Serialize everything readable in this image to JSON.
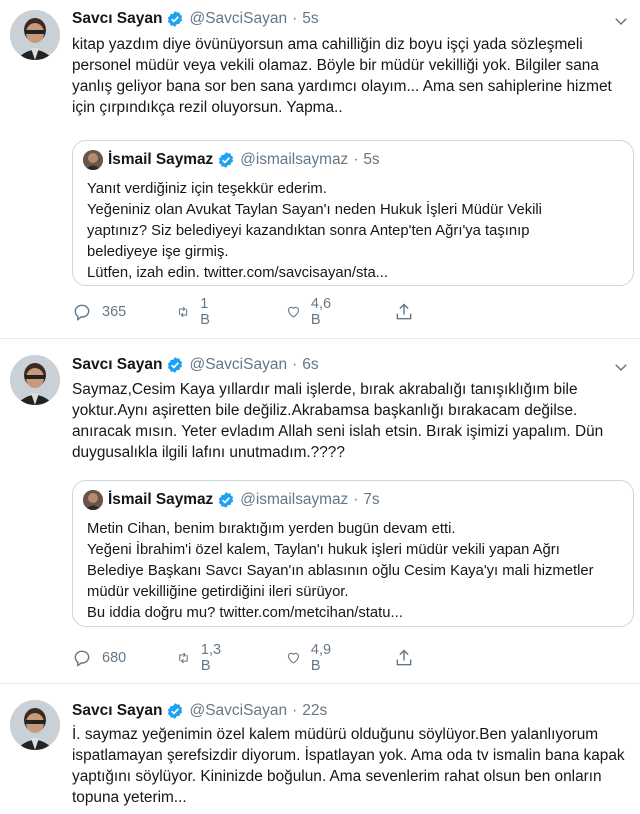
{
  "tweets": [
    {
      "name": "Savcı Sayan",
      "handle": "@SavciSayan",
      "separator": "·",
      "time": "5s",
      "text": "kitap yazdım diye övünüyorsun ama cahilliğin diz boyu işçi yada sözleşmeli personel müdür veya vekili olamaz. Böyle bir müdür vekilliği yok. Bilgiler sana yanlış geliyor bana sor ben sana yardımcı olayım... Ama sen sahiplerine hizmet için çırpındıkça rezil oluyorsun. Yapma..",
      "quote": {
        "name": "İsmail Saymaz",
        "handle": "@ismailsaymaz",
        "separator": "·",
        "time": "5s",
        "lines": [
          "Yanıt verdiğiniz için teşekkür ederim.",
          "Yeğeniniz olan Avukat Taylan Sayan'ı neden Hukuk İşleri Müdür Vekili",
          "yaptınız? Siz belediyeyi kazandıktan sonra Antep'ten Ağrı'ya taşınıp",
          "belediyeye işe girmiş.",
          "Lütfen, izah edin. twitter.com/savcisayan/sta..."
        ]
      },
      "replies": "365",
      "retweets": "1 B",
      "likes": "4,6 B"
    },
    {
      "name": "Savcı Sayan",
      "handle": "@SavciSayan",
      "separator": "·",
      "time": "6s",
      "text": "Saymaz,Cesim Kaya yıllardır mali işlerde, bırak akrabalığı tanışıklığım bile yoktur.Aynı aşiretten bile değiliz.Akrabamsa başkanlığı bırakacam değilse. anıracak mısın. Yeter evladım Allah seni islah etsin. Bırak işimizi yapalım. Dün duygusalıkla ilgili lafını unutmadım.????",
      "quote": {
        "name": "İsmail Saymaz",
        "handle": "@ismailsaymaz",
        "separator": "·",
        "time": "7s",
        "lines": [
          "Metin Cihan, benim bıraktığım yerden bugün devam etti.",
          "Yeğeni İbrahim'i özel kalem, Taylan'ı hukuk işleri müdür vekili yapan Ağrı",
          "Belediye Başkanı Savcı Sayan'ın ablasının oğlu Cesim Kaya'yı mali hizmetler",
          "müdür vekilliğine getirdiğini ileri sürüyor.",
          "Bu iddia doğru mu? twitter.com/metcihan/statu..."
        ]
      },
      "replies": "680",
      "retweets": "1,3 B",
      "likes": "4,9 B"
    },
    {
      "name": "Savcı Sayan",
      "handle": "@SavciSayan",
      "separator": "·",
      "time": "22s",
      "text": "İ. saymaz yeğenimin özel kalem müdürü olduğunu söylüyor.Ben yalanlıyorum ispatlamayan şerefsizdir diyorum. İspatlayan yok. Ama oda tv ismalin bana kapak yaptığını söylüyor. Kininizde boğulun. Ama sevenlerim rahat olsun ben onların topuna yeterim..."
    }
  ],
  "icons": {
    "verified": "verified-badge-icon",
    "reply": "reply-icon",
    "retweet": "retweet-icon",
    "like": "heart-icon",
    "share": "share-icon",
    "more": "chevron-down-icon"
  },
  "colors": {
    "verified": "#1da1f2",
    "secondary_text": "#657786",
    "border": "#ccd6dd",
    "divider": "#e6ecf0"
  }
}
